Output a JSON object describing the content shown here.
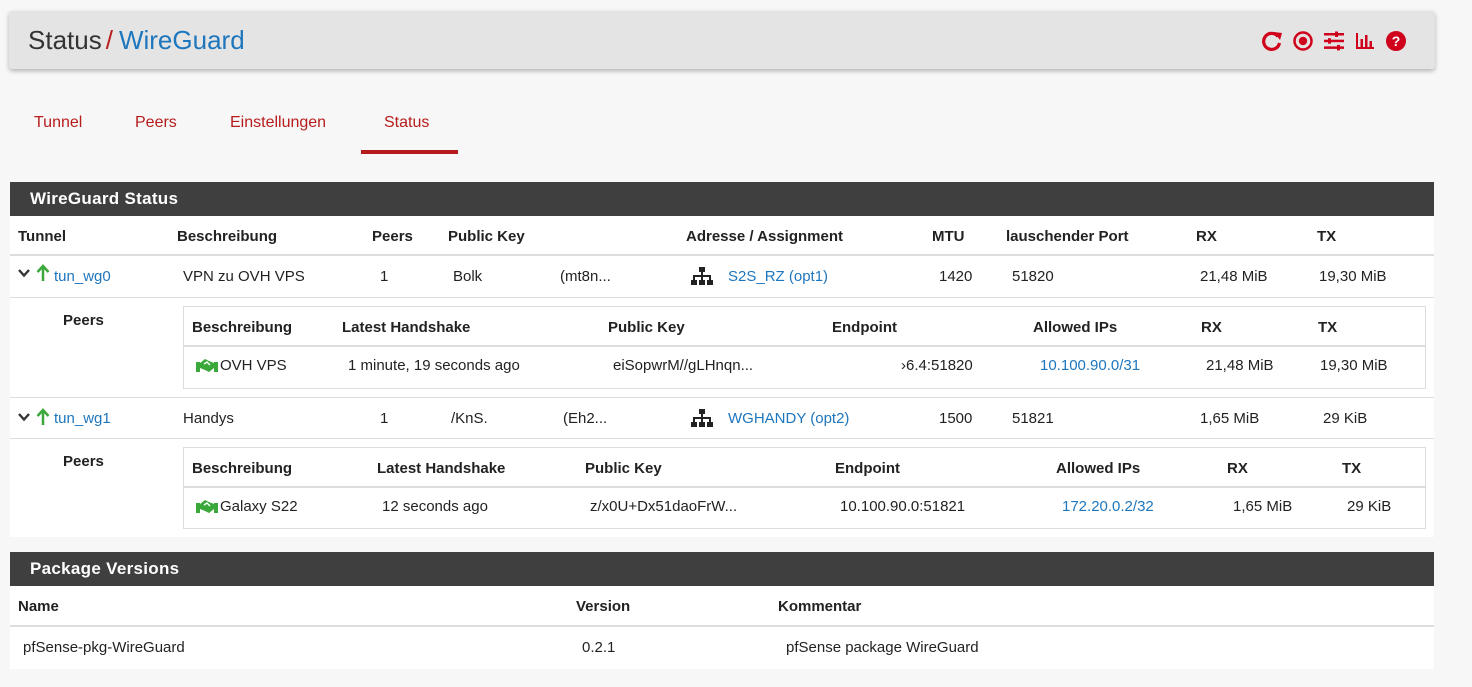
{
  "header": {
    "section": "Status",
    "separator": "/",
    "page": "WireGuard",
    "icons": [
      "reload-icon",
      "stop-circle-icon",
      "sliders-icon",
      "bar-chart-icon",
      "help-icon"
    ]
  },
  "tabs": [
    {
      "label": "Tunnel",
      "active": false
    },
    {
      "label": "Peers",
      "active": false
    },
    {
      "label": "Einstellungen",
      "active": false
    },
    {
      "label": "Status",
      "active": true
    }
  ],
  "status_panel": {
    "title": "WireGuard Status",
    "columns": [
      "Tunnel",
      "Beschreibung",
      "Peers",
      "Public Key",
      "Adresse / Assignment",
      "MTU",
      "lauschender Port",
      "RX",
      "TX"
    ],
    "tunnels": [
      {
        "name": "tun_wg0",
        "description": "VPN zu OVH VPS",
        "peers": "1",
        "public_key_start": "Bolk",
        "public_key_end": "(mt8n...",
        "assignment": "S2S_RZ (opt1)",
        "mtu": "1420",
        "port": "51820",
        "rx": "21,48 MiB",
        "tx": "19,30 MiB",
        "peers_label": "Peers",
        "peer_columns": [
          "Beschreibung",
          "Latest Handshake",
          "Public Key",
          "Endpoint",
          "Allowed IPs",
          "RX",
          "TX"
        ],
        "peer_rows": [
          {
            "description": "OVH VPS",
            "handshake": "1 minute, 19 seconds ago",
            "public_key": "eiSopwrM//gLHnqn...",
            "endpoint": "›6.4:51820",
            "allowed_ips": "10.100.90.0/31",
            "rx": "21,48 MiB",
            "tx": "19,30 MiB"
          }
        ]
      },
      {
        "name": "tun_wg1",
        "description": "Handys",
        "peers": "1",
        "public_key_start": "/KnS.",
        "public_key_end": "(Eh2...",
        "assignment": "WGHANDY (opt2)",
        "mtu": "1500",
        "port": "51821",
        "rx": "1,65 MiB",
        "tx": "29 KiB",
        "peers_label": "Peers",
        "peer_columns": [
          "Beschreibung",
          "Latest Handshake",
          "Public Key",
          "Endpoint",
          "Allowed IPs",
          "RX",
          "TX"
        ],
        "peer_rows": [
          {
            "description": "Galaxy S22",
            "handshake": "12 seconds ago",
            "public_key": "z/x0U+Dx51daoFrW...",
            "endpoint": "10.100.90.0:51821",
            "allowed_ips": "172.20.0.2/32",
            "rx": "1,65 MiB",
            "tx": "29 KiB"
          }
        ]
      }
    ]
  },
  "package_panel": {
    "title": "Package Versions",
    "columns": [
      "Name",
      "Version",
      "Kommentar"
    ],
    "rows": [
      {
        "name": "pfSense-pkg-WireGuard",
        "version": "0.2.1",
        "comment": "pfSense package WireGuard"
      }
    ]
  },
  "colors": {
    "accent_red": "#b71c1c",
    "link_blue": "#1e76bd",
    "handshake_green": "#3aa83a",
    "panel_header": "#3f3f3f"
  }
}
